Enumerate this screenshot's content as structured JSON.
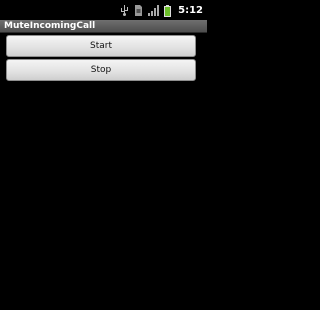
{
  "status_bar": {
    "icons": [
      "usb-icon",
      "no-sim-icon",
      "signal-icon",
      "battery-icon"
    ],
    "time": "5:12"
  },
  "title_bar": {
    "title": "MuteIncomingCall"
  },
  "main": {
    "start_label": "Start",
    "stop_label": "Stop"
  },
  "colors": {
    "background": "#000000",
    "title_bar": "#5e5e5e",
    "button_face": "#e3e3e3",
    "button_text": "#111111"
  }
}
